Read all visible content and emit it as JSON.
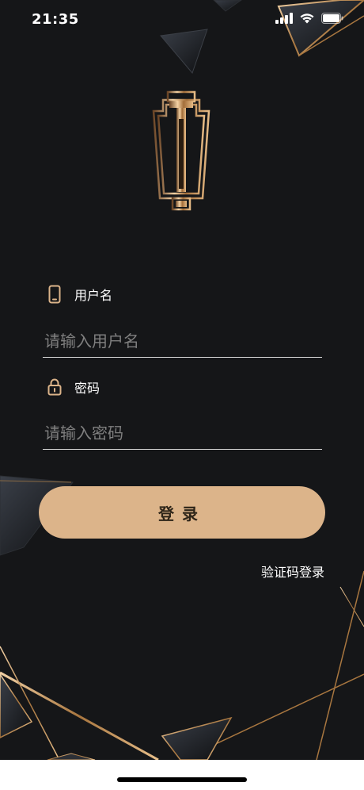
{
  "status_bar": {
    "time": "21:35",
    "icons": [
      "signal-icon",
      "wifi-icon",
      "battery-icon"
    ]
  },
  "logo": {
    "icon": "brand-logo-icon"
  },
  "username": {
    "label": "用户名",
    "placeholder": "请输入用户名",
    "value": "",
    "icon": "phone-icon"
  },
  "password": {
    "label": "密码",
    "placeholder": "请输入密码",
    "value": "",
    "icon": "lock-icon"
  },
  "login_button": {
    "label": "登录"
  },
  "code_login_link": {
    "label": "验证码登录"
  },
  "colors": {
    "background": "#151618",
    "accent_gold": "#dcb48a",
    "text": "#ffffff",
    "placeholder": "#7f7f7f"
  }
}
